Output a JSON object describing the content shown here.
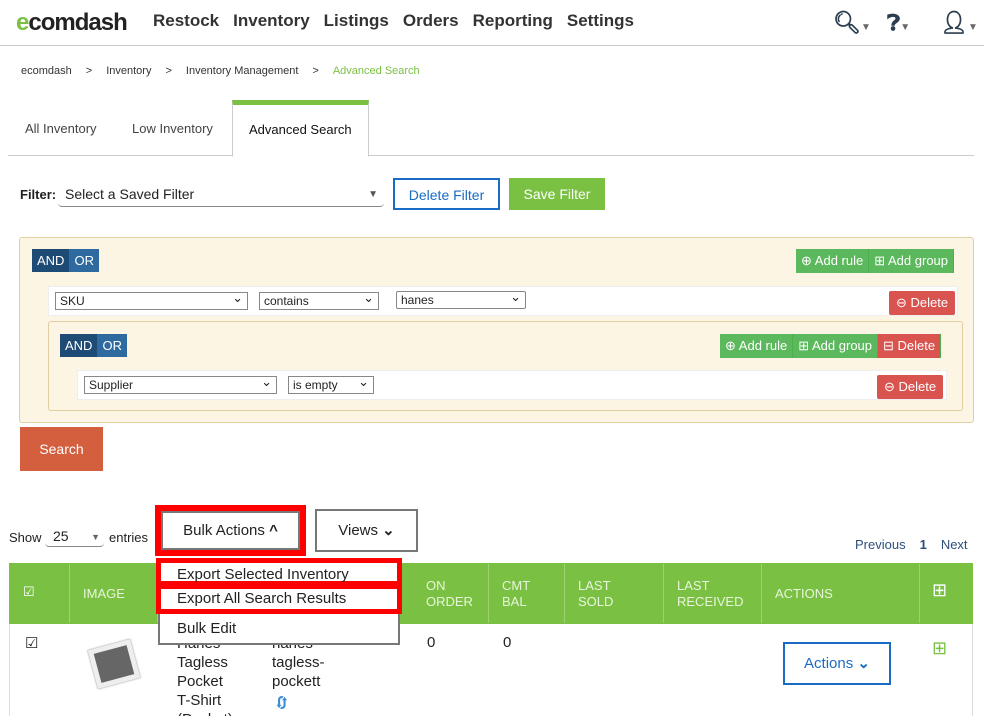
{
  "header": {
    "logo_pre": "e",
    "logo_mid": "c",
    "logo_post": "omdash",
    "nav": [
      "Restock",
      "Inventory",
      "Listings",
      "Orders",
      "Reporting",
      "Settings"
    ],
    "icons": [
      "search-icon",
      "help-icon",
      "user-icon"
    ]
  },
  "breadcrumb": [
    "ecomdash",
    ">",
    "Inventory",
    ">",
    "Inventory Management",
    ">",
    "Advanced Search"
  ],
  "tabs": [
    "All Inventory",
    "Low Inventory",
    "Advanced Search"
  ],
  "filter": {
    "label": "Filter:",
    "select": "Select a Saved Filter",
    "delete": "Delete Filter",
    "save": "Save Filter"
  },
  "query": {
    "and": "AND",
    "or": "OR",
    "add_rule": "Add rule",
    "add_group": "Add group",
    "delete": "Delete",
    "rule1": {
      "field": "SKU",
      "op": "contains",
      "value": "hanes"
    },
    "rule2": {
      "field": "Supplier",
      "op": "is empty"
    }
  },
  "search": "Search",
  "list": {
    "show": "Show",
    "entries_value": "25",
    "entries": "entries",
    "bulk": "Bulk Actions",
    "views": "Views",
    "previous": "Previous",
    "page": "1",
    "next": "Next"
  },
  "bulk_menu": [
    "Export Selected Inventory",
    "Export All Search Results",
    "Bulk Edit"
  ],
  "table": {
    "headers": [
      "IMAGE",
      "ON\nORDER",
      "CMT\nBAL",
      "LAST\nSOLD",
      "LAST\nRECEIVED",
      "ACTIONS"
    ],
    "row": {
      "name": "Hanes Tagless Pocket T-Shirt (Pocket)",
      "sku": "hanes tagless-pockett",
      "on_order": "0",
      "cmt_bal": "0",
      "actions": "Actions"
    }
  },
  "colors": {
    "green": "#7ac143",
    "blue": "#1a6bc4",
    "red": "#ff0000"
  }
}
